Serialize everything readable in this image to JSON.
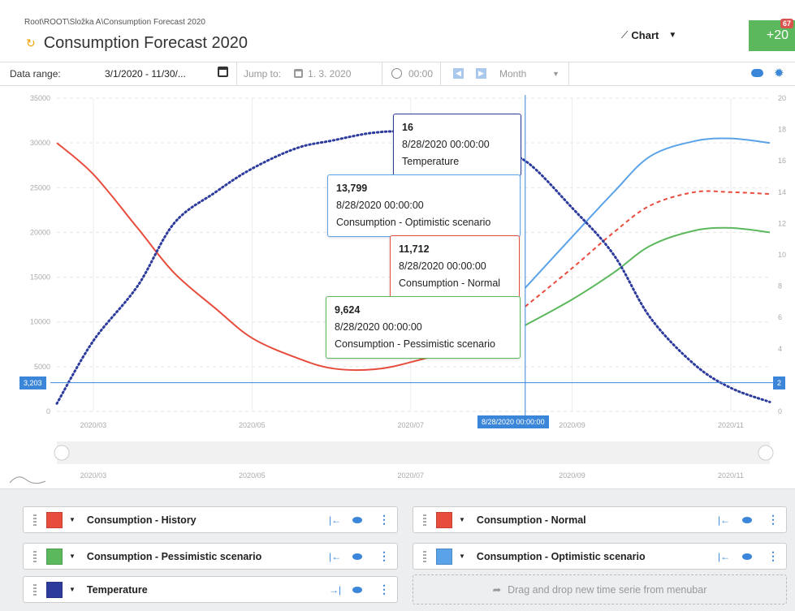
{
  "header": {
    "breadcrumb": "Root\\ROOT\\Složka A\\Consumption Forecast 2020",
    "title": "Consumption Forecast 2020",
    "view_label": "Chart",
    "add_button": "+20",
    "badge_count": "67"
  },
  "toolbar": {
    "range_label": "Data range:",
    "range_value": "3/1/2020 - 11/30/...",
    "jump_label": "Jump to:",
    "jump_date": "1. 3. 2020",
    "time": "00:00",
    "period": "Month"
  },
  "chart_data": {
    "type": "line",
    "x": [
      "2020-03-01",
      "2020-03-15",
      "2020-04-01",
      "2020-04-15",
      "2020-05-01",
      "2020-05-15",
      "2020-06-01",
      "2020-06-15",
      "2020-07-01",
      "2020-07-15",
      "2020-08-01",
      "2020-08-15",
      "2020-08-28",
      "2020-09-15",
      "2020-10-01",
      "2020-10-15",
      "2020-11-01",
      "2020-11-15",
      "2020-11-30"
    ],
    "y_left": {
      "min": 0,
      "max": 35000,
      "ticks": [
        0,
        5000,
        10000,
        15000,
        20000,
        25000,
        30000,
        35000
      ]
    },
    "y_right": {
      "min": 0,
      "max": 20,
      "ticks": [
        0,
        2,
        4,
        6,
        8,
        10,
        12,
        14,
        16,
        18,
        20
      ]
    },
    "x_ticks": [
      "2020/03",
      "2020/05",
      "2020/07",
      "2020/09",
      "2020/11"
    ],
    "grid": true,
    "series": [
      {
        "name": "Consumption - History",
        "axis": "left",
        "color": "#e74c3c",
        "style": "solid",
        "values": [
          30000,
          26500,
          20500,
          15500,
          11500,
          8200,
          6000,
          4800,
          4700,
          5500,
          7000,
          9000,
          null,
          null,
          null,
          null,
          null,
          null,
          null
        ]
      },
      {
        "name": "Consumption - Normal",
        "axis": "left",
        "color": "#e74c3c",
        "style": "dashed",
        "values": [
          null,
          null,
          null,
          null,
          null,
          null,
          null,
          null,
          null,
          null,
          null,
          null,
          11712,
          16000,
          20000,
          23000,
          24500,
          24500,
          24300
        ]
      },
      {
        "name": "Consumption - Optimistic scenario",
        "axis": "left",
        "color": "#5ba3e8",
        "style": "solid",
        "values": [
          null,
          null,
          null,
          null,
          null,
          null,
          null,
          null,
          null,
          null,
          null,
          null,
          13799,
          19500,
          24500,
          28500,
          30200,
          30500,
          30000
        ]
      },
      {
        "name": "Consumption - Pessimistic scenario",
        "axis": "left",
        "color": "#5cb85c",
        "style": "solid",
        "values": [
          null,
          null,
          null,
          null,
          null,
          null,
          null,
          null,
          null,
          null,
          null,
          null,
          9624,
          12500,
          15500,
          18500,
          20200,
          20500,
          20000
        ]
      },
      {
        "name": "Temperature",
        "axis": "right",
        "color": "#2d3b9c",
        "style": "dotted",
        "values": [
          0.5,
          4.5,
          8,
          12,
          14,
          15.5,
          16.8,
          17.3,
          17.8,
          17.8,
          17,
          16.5,
          16,
          13,
          10,
          6,
          3,
          1.5,
          0.6
        ]
      }
    ],
    "crosshair": {
      "x": "8/28/2020 00:00:00",
      "y_left": "3,203",
      "y_right": "2"
    },
    "tooltips": [
      {
        "value": "16",
        "date": "8/28/2020 00:00:00",
        "series": "Temperature",
        "color": "#2d3b9c"
      },
      {
        "value": "13,799",
        "date": "8/28/2020 00:00:00",
        "series": "Consumption - Optimistic scenario",
        "color": "#5ba3e8"
      },
      {
        "value": "11,712",
        "date": "8/28/2020 00:00:00",
        "series": "Consumption - Normal",
        "color": "#e74c3c"
      },
      {
        "value": "9,624",
        "date": "8/28/2020 00:00:00",
        "series": "Consumption - Pessimistic scenario",
        "color": "#5cb85c"
      }
    ]
  },
  "series_panel": [
    {
      "name": "Consumption - History",
      "color": "#e74c3c",
      "axis": "left"
    },
    {
      "name": "Consumption - Normal",
      "color": "#e74c3c",
      "axis": "left"
    },
    {
      "name": "Consumption - Pessimistic scenario",
      "color": "#5cb85c",
      "axis": "left"
    },
    {
      "name": "Consumption - Optimistic scenario",
      "color": "#5ba3e8",
      "axis": "left"
    },
    {
      "name": "Temperature",
      "color": "#2d3b9c",
      "axis": "right"
    }
  ],
  "dropzone_text": "Drag and drop new time serie from menubar"
}
